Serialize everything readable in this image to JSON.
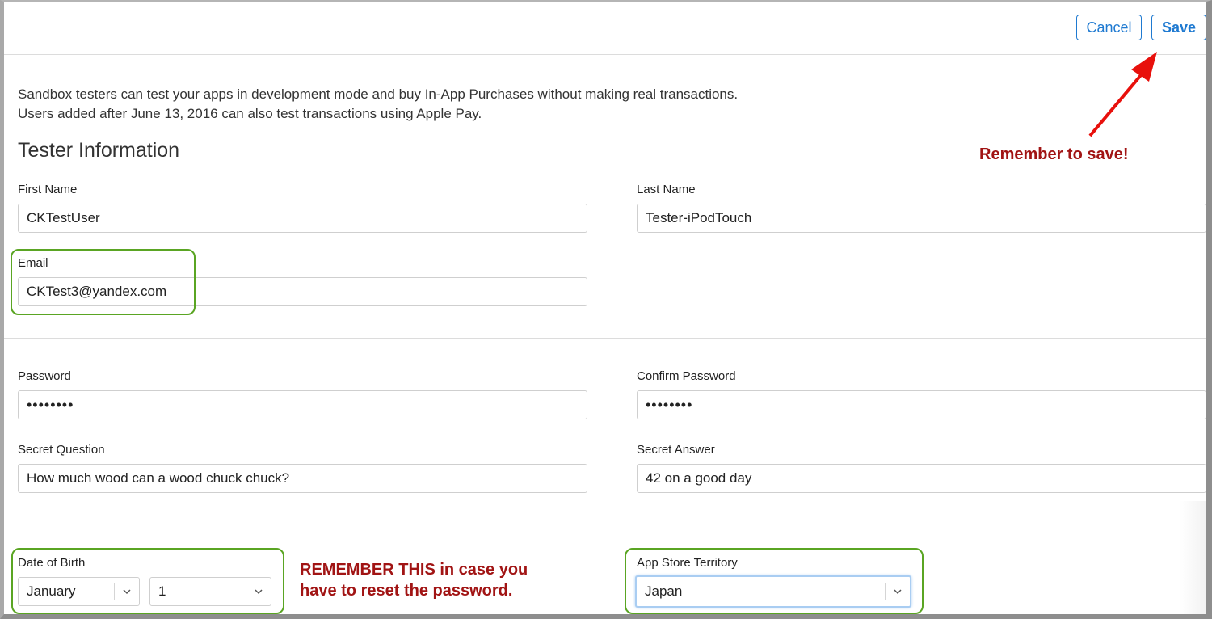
{
  "toolbar": {
    "cancel_label": "Cancel",
    "save_label": "Save"
  },
  "intro": {
    "line1": "Sandbox testers can test your apps in development mode and buy In-App Purchases without making real transactions.",
    "line2": "Users added after June 13, 2016 can also test transactions using Apple Pay."
  },
  "section_title": "Tester Information",
  "form": {
    "first_name": {
      "label": "First Name",
      "value": "CKTestUser"
    },
    "last_name": {
      "label": "Last Name",
      "value": "Tester-iPodTouch"
    },
    "email": {
      "label": "Email",
      "value": "CKTest3@yandex.com"
    },
    "password": {
      "label": "Password",
      "value": "••••••••"
    },
    "confirm_password": {
      "label": "Confirm Password",
      "value": "••••••••"
    },
    "secret_question": {
      "label": "Secret Question",
      "value": "How much wood can a wood chuck chuck?"
    },
    "secret_answer": {
      "label": "Secret Answer",
      "value": "42 on a good day"
    },
    "date_of_birth": {
      "label": "Date of Birth",
      "month": "January",
      "day": "1"
    },
    "territory": {
      "label": "App Store Territory",
      "value": "Japan"
    }
  },
  "annotations": {
    "save_note": "Remember to save!",
    "dob_note_line1": "REMEMBER THIS in case you",
    "dob_note_line2": "have to reset the password."
  },
  "colors": {
    "accent": "#1f7ad1",
    "annotation_red": "#a11414",
    "highlight_green": "#5aa523",
    "arrow_red": "#e8100c"
  },
  "icons": {
    "select_chevron": "chevron-down-icon"
  }
}
